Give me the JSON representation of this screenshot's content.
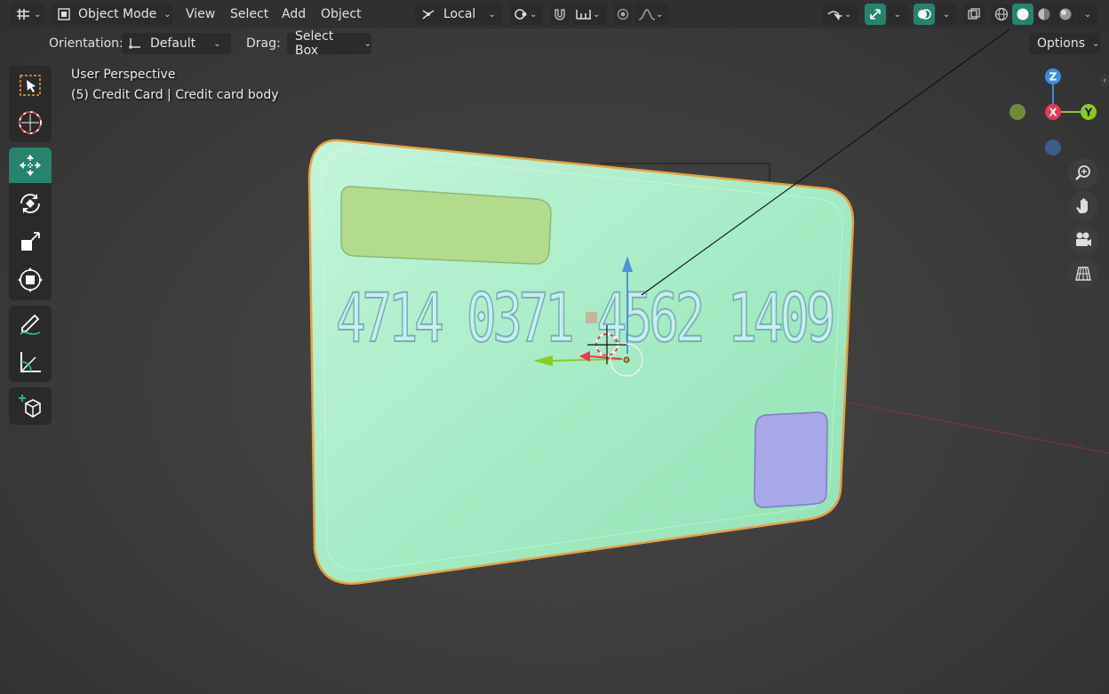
{
  "header": {
    "mode_label": "Object Mode",
    "menus": [
      "View",
      "Select",
      "Add",
      "Object"
    ],
    "transform_orientation": "Local"
  },
  "tool_settings": {
    "orientation_label": "Orientation:",
    "orientation_value": "Default",
    "drag_label": "Drag:",
    "drag_value": "Select Box",
    "options_label": "Options"
  },
  "viewport": {
    "view_name": "User Perspective",
    "object_info": "(5) Credit Card | Credit card body",
    "card_number": "4714 0371 4562 1409"
  },
  "gizmo": {
    "x_label": "X",
    "y_label": "Y",
    "z_label": "Z"
  },
  "colors": {
    "accent": "#27836e",
    "header_bg": "#303030",
    "card_fill": "#a6ecc4",
    "card_outline": "#e8a040",
    "chip": "#b2dc8c",
    "square_patch": "#a8a8e8",
    "axis_x": "#ee3355",
    "axis_y": "#88cc22",
    "axis_z": "#3c8ce8"
  },
  "toolbar_icons": [
    "select-box-icon",
    "cursor-icon",
    "move-icon",
    "rotate-icon",
    "scale-icon",
    "transform-icon",
    "annotate-icon",
    "measure-icon",
    "add-cube-icon"
  ],
  "nav_icons": [
    "zoom-icon",
    "hand-icon",
    "camera-icon",
    "grid-icon"
  ]
}
